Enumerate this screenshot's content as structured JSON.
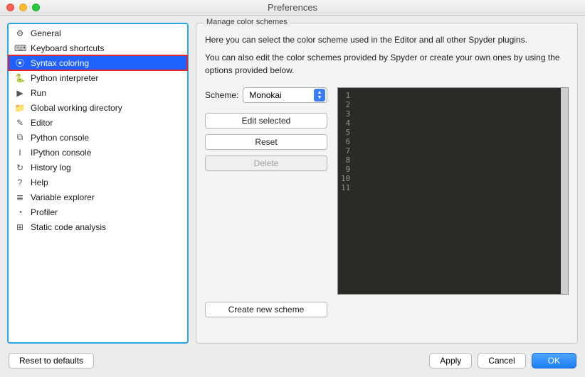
{
  "window": {
    "title": "Preferences"
  },
  "sidebar": {
    "items": [
      {
        "icon": "⚙",
        "label": "General"
      },
      {
        "icon": "⌨",
        "label": "Keyboard shortcuts"
      },
      {
        "icon": "⦿",
        "label": "Syntax coloring"
      },
      {
        "icon": "🐍",
        "label": "Python interpreter"
      },
      {
        "icon": "▶",
        "label": "Run"
      },
      {
        "icon": "📁",
        "label": "Global working directory"
      },
      {
        "icon": "✎",
        "label": "Editor"
      },
      {
        "icon": "⧉",
        "label": "Python console"
      },
      {
        "icon": "I",
        "label": "IPython console"
      },
      {
        "icon": "↻",
        "label": "History log"
      },
      {
        "icon": "?",
        "label": "Help"
      },
      {
        "icon": "≣",
        "label": "Variable explorer"
      },
      {
        "icon": "◔",
        "label": "Profiler"
      },
      {
        "icon": "⊞",
        "label": "Static code analysis"
      }
    ],
    "selected_index": 2
  },
  "panel": {
    "group_title": "Manage color schemes",
    "description_1": "Here you can select the color scheme used in the Editor and all other Spyder plugins.",
    "description_2": "You can also edit the color schemes provided by Spyder or create your own ones by using the options provided below.",
    "scheme_label": "Scheme:",
    "scheme_value": "Monokai",
    "edit_selected": "Edit selected",
    "reset": "Reset",
    "delete": "Delete",
    "delete_disabled": true,
    "create_new": "Create new scheme",
    "preview_lines": [
      "1",
      "2",
      "3",
      "4",
      "5",
      "6",
      "7",
      "8",
      "9",
      "10",
      "11"
    ]
  },
  "footer": {
    "reset_defaults": "Reset to defaults",
    "apply": "Apply",
    "cancel": "Cancel",
    "ok": "OK"
  }
}
